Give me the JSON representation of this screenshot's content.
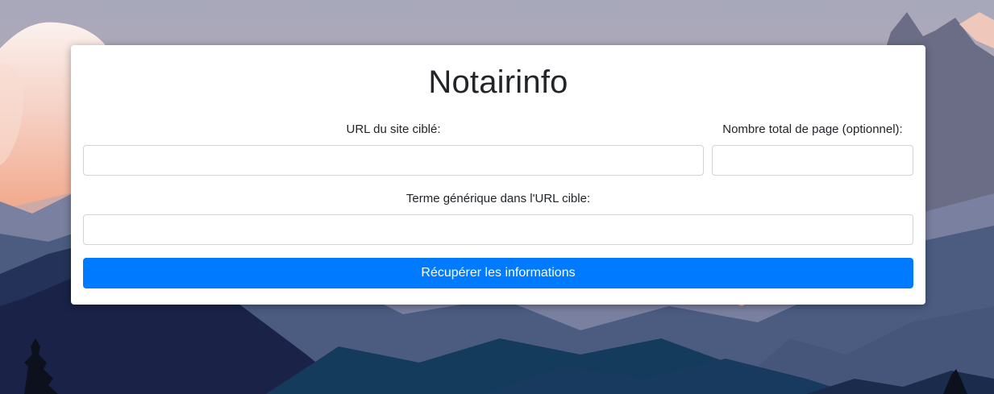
{
  "app": {
    "title": "Notairinfo"
  },
  "form": {
    "url_label": "URL du site ciblé:",
    "url_value": "",
    "pages_label": "Nombre total de page (optionnel):",
    "pages_value": "",
    "term_label": "Terme générique dans l'URL cible:",
    "term_value": "",
    "submit_label": "Récupérer les informations"
  },
  "colors": {
    "button": "#007bff",
    "card": "#ffffff",
    "sky_top": "#a9a9bb",
    "sky_glow": "#f4b7a2"
  }
}
